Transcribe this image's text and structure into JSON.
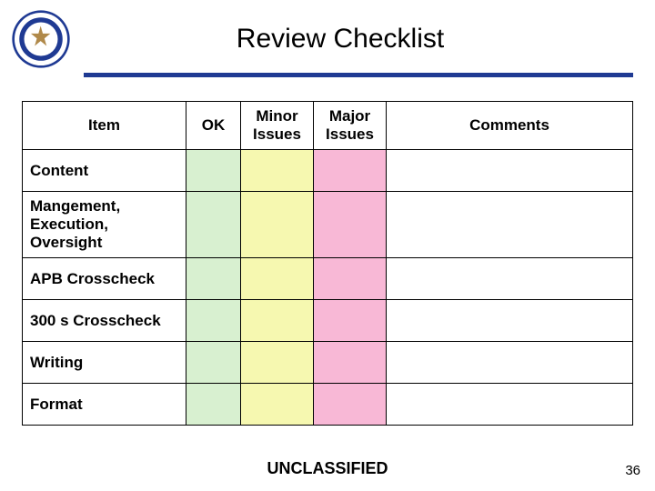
{
  "header": {
    "title": "Review Checklist",
    "seal_alt": "Department of Defense seal"
  },
  "table": {
    "headers": {
      "item": "Item",
      "ok": "OK",
      "minor": "Minor Issues",
      "major": "Major Issues",
      "comments": "Comments"
    },
    "rows": [
      {
        "item": "Content"
      },
      {
        "item": "Mangement, Execution, Oversight"
      },
      {
        "item": "APB Crosscheck"
      },
      {
        "item": "300 s Crosscheck"
      },
      {
        "item": "Writing"
      },
      {
        "item": "Format"
      }
    ]
  },
  "footer": {
    "classification": "UNCLASSIFIED",
    "page": "36"
  },
  "colors": {
    "rule": "#1f3a93",
    "ok": "#d8f0d0",
    "minor": "#f6f8b0",
    "major": "#f8b8d6"
  }
}
